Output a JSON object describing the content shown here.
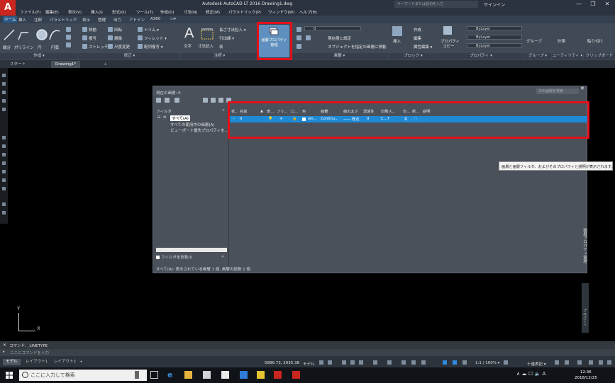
{
  "app": {
    "title": "Autodesk AutoCAD LT 2016    Drawing1.dwg",
    "logo": "A",
    "search_placeholder": "キーワードまたは語句を入力",
    "signin": "サインイン",
    "win_controls": [
      "—",
      "❐",
      "✕"
    ]
  },
  "menu": [
    "ファイル(F)",
    "編集(E)",
    "表示(V)",
    "挿入(I)",
    "形式(O)",
    "ツール(T)",
    "作成(D)",
    "寸法(N)",
    "修正(M)",
    "パラメトリック(P)",
    "ウィンドウ(W)",
    "ヘルプ(H)"
  ],
  "ribbon_tabs": [
    "ホーム",
    "挿入",
    "注釈",
    "パラメトリック",
    "表示",
    "管理",
    "出力",
    "アドイン",
    "A360",
    "▭▾"
  ],
  "ribbon": {
    "draw_tools": [
      "線分",
      "ポリライン",
      "円",
      "円弧"
    ],
    "modify_tools": [
      [
        "移動",
        "回転",
        "トリム ▾"
      ],
      [
        "複写",
        "鏡像",
        "フィレット ▾"
      ],
      [
        "ストレッチ",
        "尺度変更",
        "配列複写 ▾"
      ]
    ],
    "text_tool": "文字",
    "dim_tool": "寸法記入",
    "annot_tools": [
      "長さ寸法記入 ▾",
      "引出線 ▾",
      "表"
    ],
    "layer_props_button": "画層プロパティ管理",
    "layer_combo": "0",
    "layer_tools": [
      "現在層に設定",
      "オブジェクトを指定の画層に移動"
    ],
    "block_tools": [
      "挿入",
      "作成",
      "編集",
      "属性編集 ▾"
    ],
    "props_tools": [
      "プロパティ",
      "コピー"
    ],
    "bylayer": [
      "ByLayer",
      "ByLayer",
      "ByLayer"
    ],
    "group_tool": "グループ",
    "measure_tool": "計測",
    "paste_tool": "貼り付け",
    "panels": [
      "作成 ▾",
      "修正 ▾",
      "注釈 ▾",
      "画層 ▾",
      "ブロック ▾",
      "プロパティ ▾",
      "グループ ▾",
      "ユーティリティ ▾",
      "クリップボード"
    ]
  },
  "file_tabs": [
    "スタート",
    "Drawing1*",
    "+"
  ],
  "layer_manager": {
    "current_layer": "現在の画層: 0",
    "search_placeholder": "次の画層を検索",
    "filters_header": "フィルタ",
    "collapse": "«",
    "tree": [
      "すべて(A)",
      "すべての使用中の画層(A)",
      "ビューポート優先プロパティを..."
    ],
    "invert_filter": "フィルタを反転(I)",
    "status": "すべて(A): 表示されている画層 1 個, 画層の総数 1 個",
    "columns": [
      "状...",
      "名前",
      "▲",
      "表...",
      "フリ...",
      "ロ...",
      "色",
      "線種",
      "線の太さ",
      "透過性",
      "印刷ス...",
      "印...",
      "新...",
      "説明"
    ],
    "rows": [
      {
        "status": "✓",
        "name": "0",
        "on": "💡",
        "freeze": "☀",
        "lock": "🔓",
        "color": "wh...",
        "linetype": "Continu...",
        "lineweight": "—— 既定",
        "transparency": "0",
        "plotstyle": "C...7",
        "plot": "⎙",
        "new": "⬚"
      }
    ],
    "side_label": "画層プロパティ管理",
    "close": "✕"
  },
  "tooltip": "画層と画層フィルタ、およびそのプロパティと説明が表示されます。",
  "right_panel_label": "プロパティ",
  "ucs": {
    "x": "X",
    "y": "Y"
  },
  "command": {
    "history": "コマンド: _LINETYPE",
    "placeholder": "ここにコマンドを入力",
    "close": "✕"
  },
  "layout_tabs": [
    "モデル",
    "レイアウト1",
    "レイアウト2",
    "+"
  ],
  "status": {
    "coords": "5886.73, 2035.38",
    "model": "モデル",
    "scale": "1:1 / 100% ▾",
    "annot": "十進表記 ▾"
  },
  "taskbar": {
    "search": "ここに入力して検索",
    "clock_time": "12:36",
    "clock_date": "2018/12/25",
    "tray": "∧ ☁ 🖵 🔈 A"
  },
  "colors": {
    "accent": "#1e8ad6",
    "highlight_box": "#e3101a",
    "autocad_red": "#c8261e"
  }
}
